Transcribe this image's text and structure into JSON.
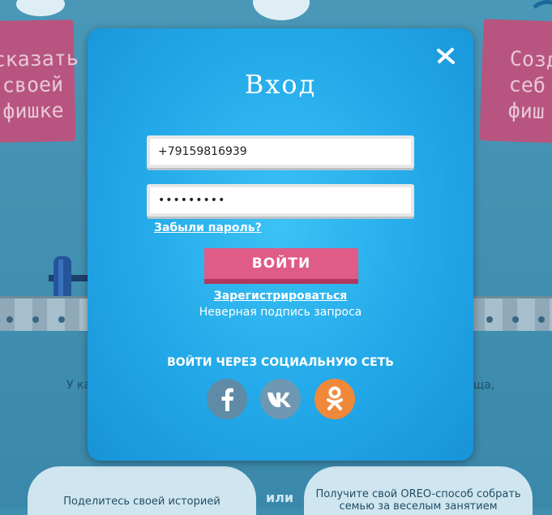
{
  "background": {
    "sticky_left_lines": [
      "сказать",
      "своей",
      "фишке"
    ],
    "sticky_right_lines": [
      "Созд",
      "себ",
      "фиш"
    ],
    "partial_left_text": "У ка",
    "partial_right_text": "ща,",
    "separator_text": "или",
    "bubble_left_text": "Поделитесь своей историей",
    "bubble_right_line1": "Получите свой OREO-способ собрать",
    "bubble_right_line2": "семью за веселым занятием"
  },
  "modal": {
    "title": "Вход",
    "close_icon": "close-x-icon",
    "phone_value": "+79159816939",
    "password_value": "•••••••••",
    "forgot_password": "Забыли пароль?",
    "login_button": "ВОЙТИ",
    "register_link": "Зарегистрироваться",
    "error_message": "Неверная подпись запроса",
    "social_heading": "ВОЙТИ ЧЕРЕЗ СОЦИАЛЬНУЮ СЕТЬ",
    "social": [
      {
        "icon": "facebook-icon",
        "color": "#5f8ba6"
      },
      {
        "icon": "vk-icon",
        "color": "#6e98b2"
      },
      {
        "icon": "odnoklassniki-icon",
        "color": "#f0883a"
      }
    ],
    "colors": {
      "accent": "#df5b88",
      "modal_blue": "#22a8e8"
    }
  }
}
